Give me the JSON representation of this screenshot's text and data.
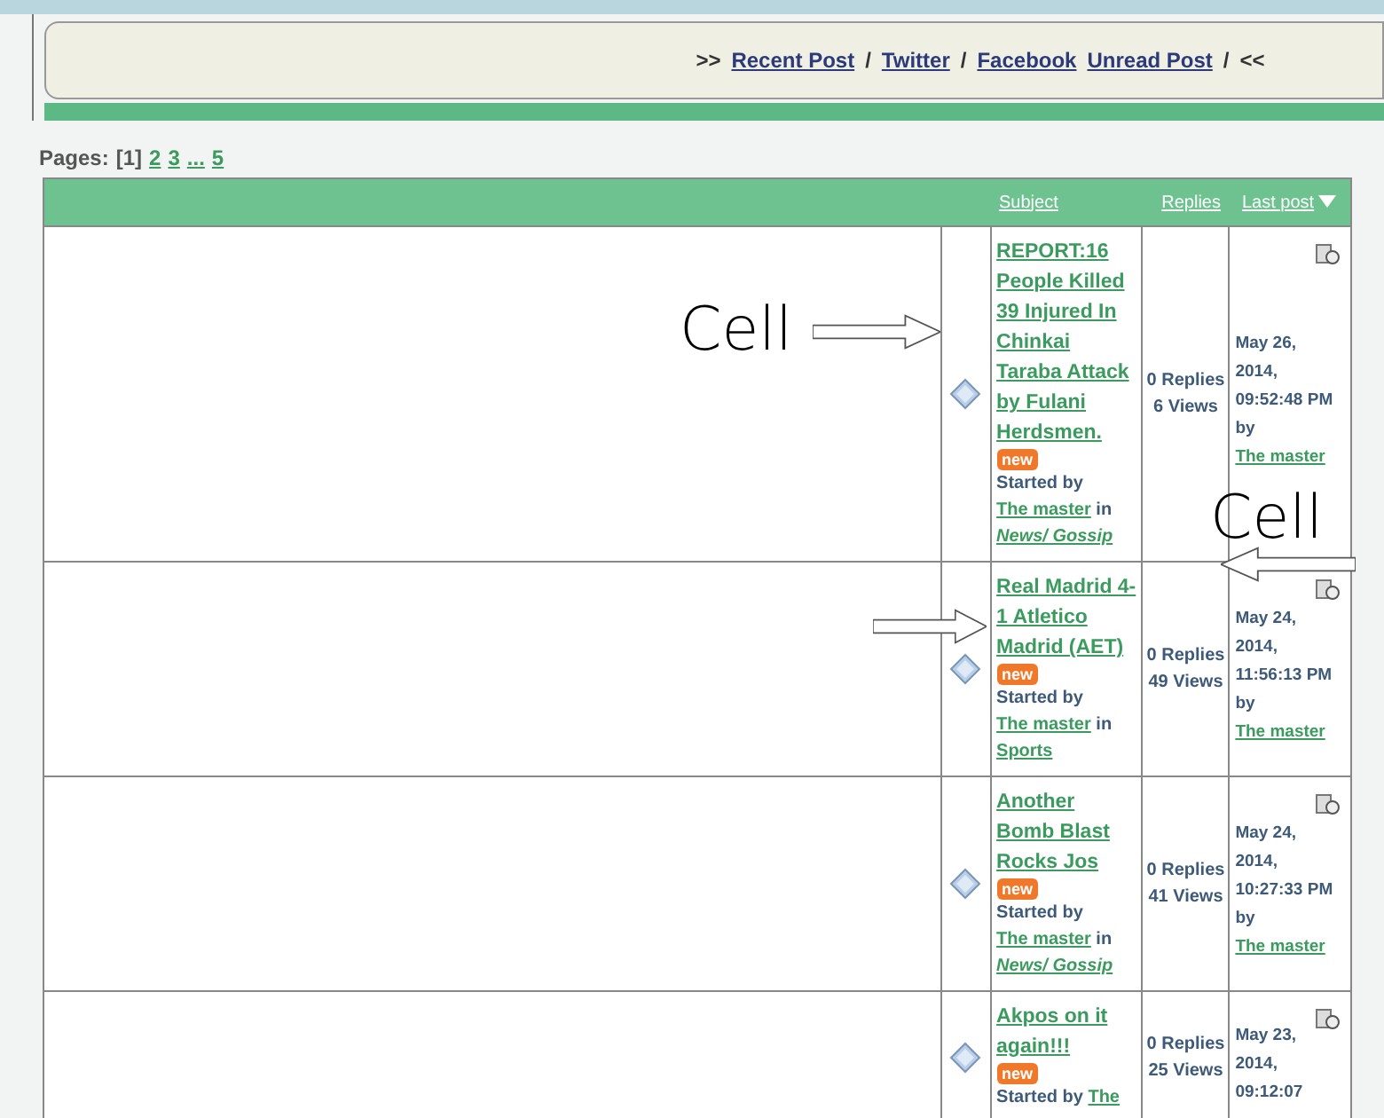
{
  "nav": [
    {
      "kind": "text",
      "label": ">>"
    },
    {
      "kind": "link",
      "label": "Recent Post"
    },
    {
      "kind": "text",
      "label": "/"
    },
    {
      "kind": "link",
      "label": "Twitter"
    },
    {
      "kind": "text",
      "label": "/"
    },
    {
      "kind": "link",
      "label": "Facebook"
    },
    {
      "kind": "link",
      "label": "Unread Post"
    },
    {
      "kind": "text",
      "label": "/"
    },
    {
      "kind": "text",
      "label": "<<"
    }
  ],
  "pages": {
    "label": "Pages:",
    "items": [
      {
        "label": "[1]",
        "selected": true
      },
      {
        "label": "2",
        "selected": false
      },
      {
        "label": "3",
        "selected": false
      },
      {
        "label": "...",
        "selected": false
      },
      {
        "label": "5",
        "selected": false
      }
    ]
  },
  "table": {
    "columns": [
      "Subject",
      "Replies",
      "Last post"
    ],
    "rows": [
      {
        "subject": "REPORT:16 People Killed 39 Injured In Chinkai Taraba Attack by Fulani Herdsmen.",
        "badge": "new",
        "started_by": "Started by",
        "author": "The master",
        "in": "in",
        "board": "News/ Gossip",
        "board_italic": true,
        "replies": "0 Replies",
        "views": "6 Views",
        "last_date": "May 26, 2014, 09:52:48 PM",
        "by": "by",
        "last_author": "The master"
      },
      {
        "subject": "Real Madrid 4-1 Atletico Madrid (AET)",
        "badge": "new",
        "started_by": "Started by",
        "author": "The master",
        "in": "in",
        "board": "Sports",
        "board_italic": false,
        "replies": "0 Replies",
        "views": "49 Views",
        "last_date": "May 24, 2014, 11:56:13 PM",
        "by": "by",
        "last_author": "The master"
      },
      {
        "subject": "Another Bomb Blast Rocks Jos",
        "badge": "new",
        "started_by": "Started by",
        "author": "The master",
        "in": "in",
        "board": "News/ Gossip",
        "board_italic": true,
        "replies": "0 Replies",
        "views": "41 Views",
        "last_date": "May 24, 2014, 10:27:33 PM",
        "by": "by",
        "last_author": "The master"
      },
      {
        "subject": "Akpos on it again!!!",
        "badge": "new",
        "started_by": "Started by",
        "author": "The",
        "replies": "0 Replies",
        "views": "25 Views",
        "last_date": "May 23, 2014, 09:12:07"
      }
    ]
  },
  "annotations": [
    {
      "label": "Cell"
    },
    {
      "label": "Cell"
    }
  ]
}
